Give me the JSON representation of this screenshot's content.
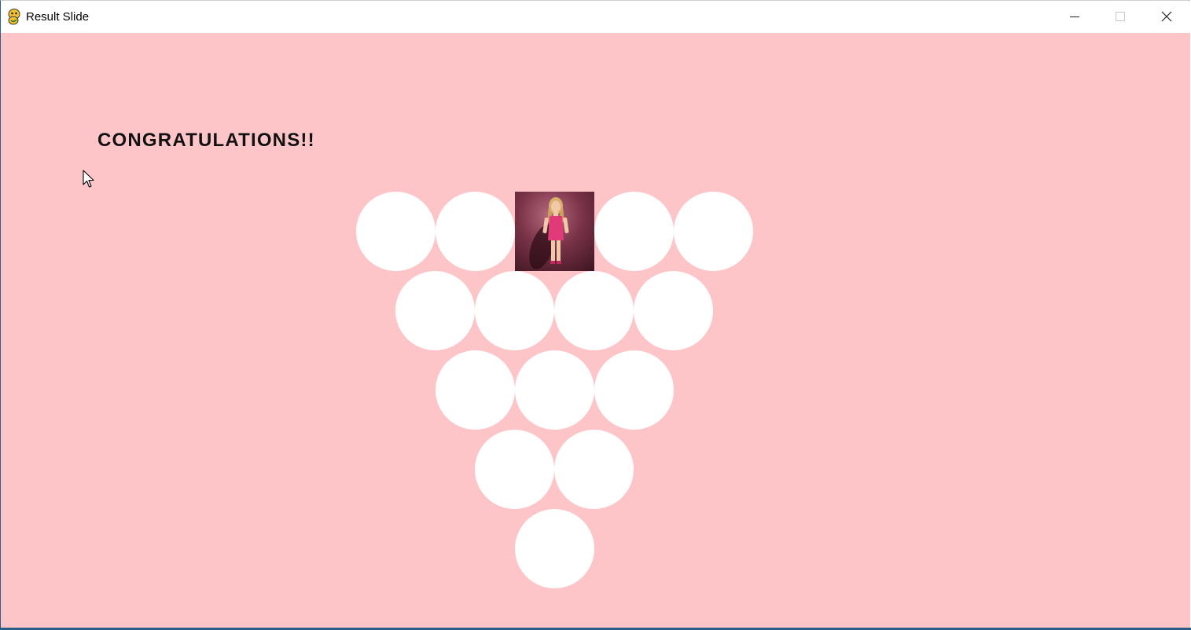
{
  "window": {
    "title": "Result Slide",
    "app_icon": "pygame-snake-icon",
    "controls": [
      "minimize-icon",
      "maximize-icon",
      "close-icon"
    ]
  },
  "content": {
    "heading": "CONGRATULATIONS!!",
    "background_color": "#fec5c9",
    "circle_color": "#ffffff",
    "revealed_image": "doll-in-pink-dress-photo",
    "grid_rows": [
      5,
      4,
      3,
      2,
      1
    ],
    "revealed_position": {
      "row": 1,
      "column": 3
    }
  }
}
